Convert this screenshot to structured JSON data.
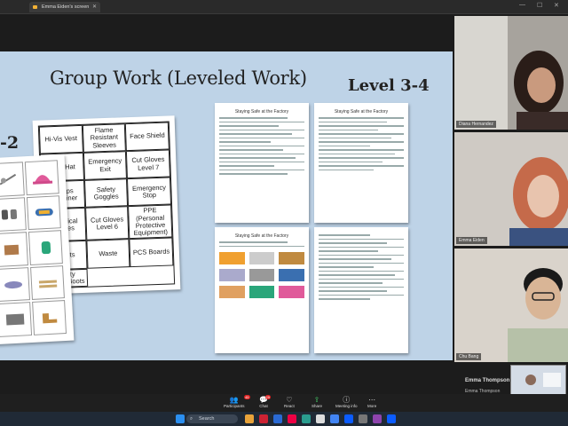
{
  "window": {
    "tab_title": "Emma Eiden's screen"
  },
  "slide": {
    "title": "Group Work (Leveled Work)",
    "level_label": "Level 3-4",
    "partial_label": "-2",
    "cards": [
      "Hi-Vis Vest",
      "Flame Resistant Sleeves",
      "Face Shield",
      "Hard Hat",
      "",
      "Emergency Exit",
      "Cut Gloves Level 7",
      "Sharps Container",
      "",
      "Safety Goggles",
      "Emergency Stop",
      "Chemical Gloves",
      "",
      "Cut Gloves Level 6",
      "PPE (Personal Protective Equipment)",
      "Pallets",
      "",
      "Waste",
      "PCS Boards",
      "Safety Shoes/Boots"
    ],
    "worksheet_title": "Staying Safe at the Factory"
  },
  "participants": [
    {
      "name": "Diana Hernandez"
    },
    {
      "name": "Emma Eiden"
    },
    {
      "name": "Chu Bang"
    }
  ],
  "speaker_name": "Emma Thompson",
  "speaker_tile_name": "Emma Thompson",
  "toolbar": [
    {
      "label": "Participants",
      "icon": "people-icon",
      "count": "45"
    },
    {
      "label": "Chat",
      "icon": "chat-icon",
      "count": "29"
    },
    {
      "label": "React",
      "icon": "heart-icon"
    },
    {
      "label": "Share",
      "icon": "share-icon"
    },
    {
      "label": "Meeting info",
      "icon": "info-icon"
    },
    {
      "label": "More",
      "icon": "more-icon"
    }
  ],
  "taskbar": {
    "search_placeholder": "Search"
  }
}
